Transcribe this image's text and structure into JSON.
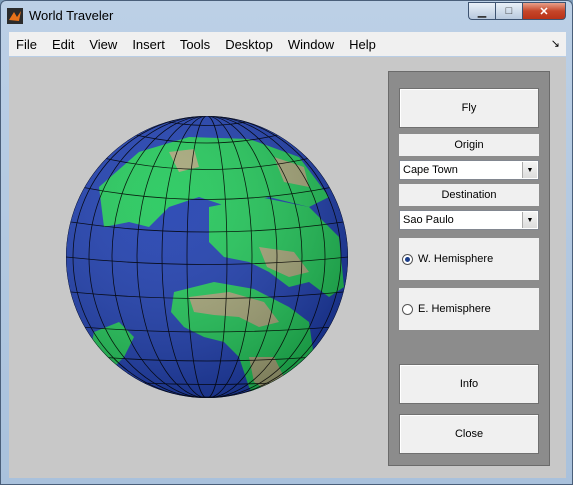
{
  "window": {
    "title": "World Traveler"
  },
  "menu": [
    "File",
    "Edit",
    "View",
    "Insert",
    "Tools",
    "Desktop",
    "Window",
    "Help"
  ],
  "controls": {
    "fly_label": "Fly",
    "origin_label": "Origin",
    "origin_value": "Cape Town",
    "destination_label": "Destination",
    "destination_value": "Sao Paulo",
    "hemisphere_options": [
      {
        "label": "W. Hemisphere",
        "selected": true
      },
      {
        "label": "E. Hemisphere",
        "selected": false
      }
    ],
    "info_label": "Info",
    "close_label": "Close"
  },
  "colors": {
    "ocean": "#1f3fb0",
    "land": "#22c85a",
    "desert": "#a7a87a",
    "figure_bg": "#c8c8c8"
  }
}
